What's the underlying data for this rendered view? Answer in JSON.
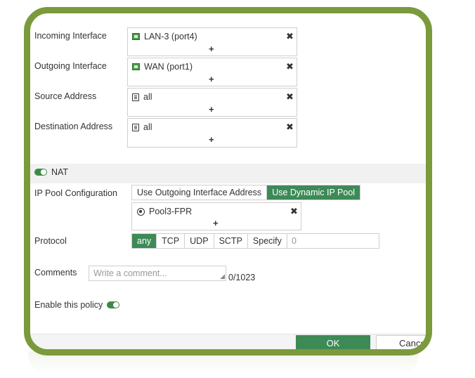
{
  "interfaces": {
    "incoming": {
      "label": "Incoming Interface",
      "value": "LAN-3 (port4)"
    },
    "outgoing": {
      "label": "Outgoing Interface",
      "value": "WAN (port1)"
    }
  },
  "addresses": {
    "source": {
      "label": "Source Address",
      "value": "all"
    },
    "destination": {
      "label": "Destination Address",
      "value": "all"
    }
  },
  "symbols": {
    "remove": "✖",
    "add": "+"
  },
  "nat": {
    "label": "NAT",
    "enabled": true
  },
  "ip_pool": {
    "label": "IP Pool Configuration",
    "options": [
      "Use Outgoing Interface Address",
      "Use Dynamic IP Pool"
    ],
    "selected": "Use Dynamic IP Pool",
    "pool_value": "Pool3-FPR"
  },
  "protocol": {
    "label": "Protocol",
    "options": [
      "any",
      "TCP",
      "UDP",
      "SCTP",
      "Specify"
    ],
    "selected": "any",
    "number_value": "0"
  },
  "comments": {
    "label": "Comments",
    "placeholder": "Write a comment...",
    "counter": "0/1023"
  },
  "enable_policy": {
    "label": "Enable this policy",
    "enabled": true
  },
  "buttons": {
    "ok": "OK",
    "cancel": "Cance"
  },
  "colors": {
    "frame": "#7a9a3c",
    "accent": "#3d8a56"
  }
}
